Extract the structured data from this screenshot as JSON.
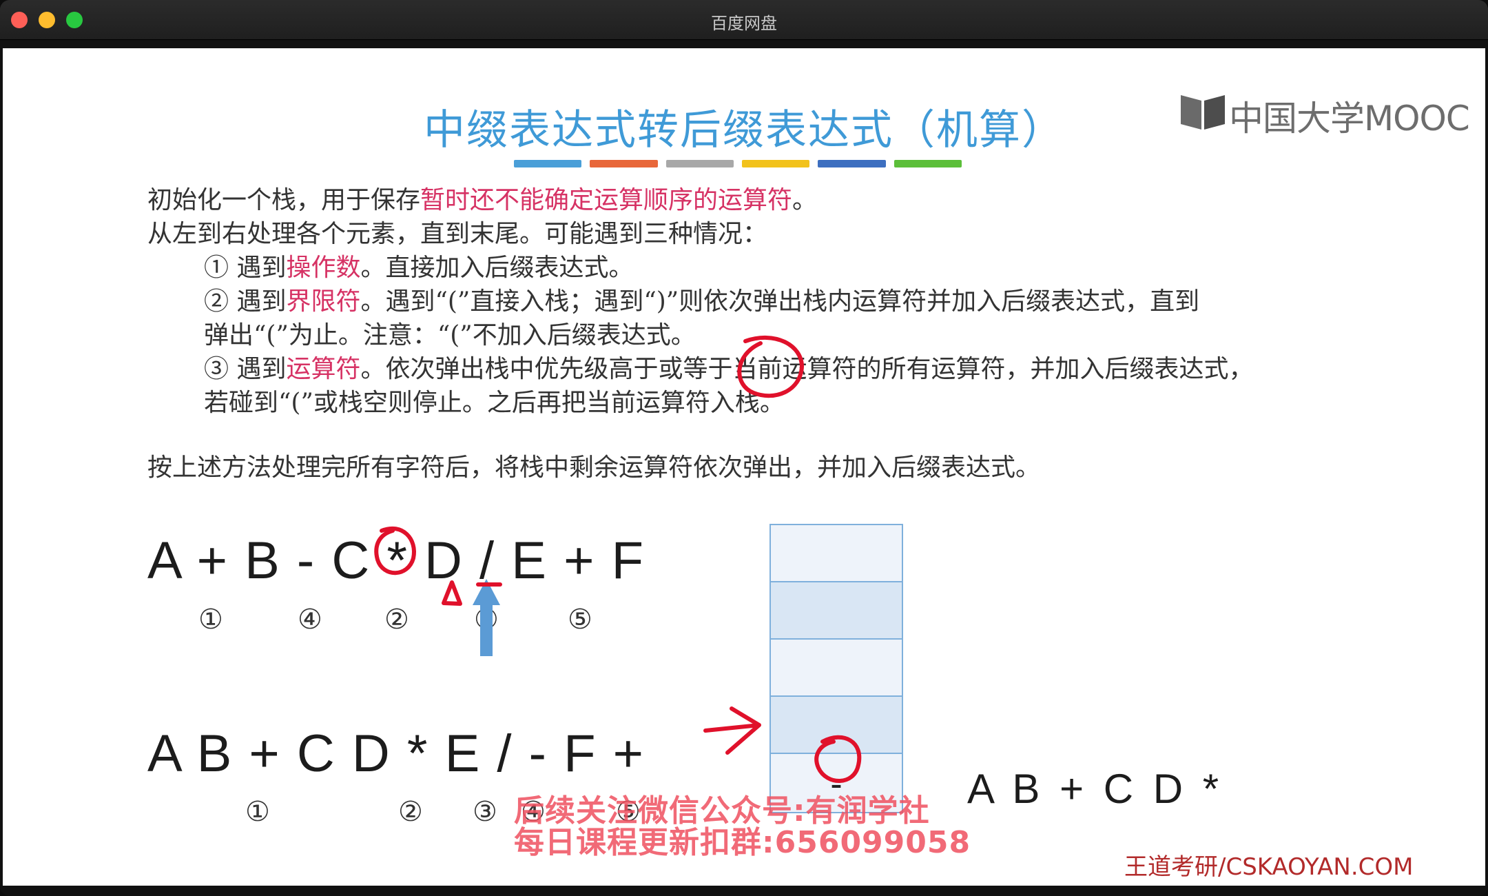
{
  "window": {
    "title": "百度网盘"
  },
  "slide": {
    "logo_text": "中国大学MOOC",
    "title": "中缀表达式转后缀表达式（机算）",
    "accent_bars": [
      "#4a9fd8",
      "#e8673a",
      "#a8a8a8",
      "#f2c21b",
      "#3d6fc0",
      "#5cbf3a"
    ],
    "lines": {
      "l1_pre": "初始化一个栈，用于保存",
      "l1_hl": "暂时还不能确定运算顺序的运算符",
      "l1_post": "。",
      "l2": "从左到右处理各个元素，直到末尾。可能遇到三种情况：",
      "c1_pre": "① 遇到",
      "c1_hl": "操作数",
      "c1_post": "。直接加入后缀表达式。",
      "c2_pre": "② 遇到",
      "c2_hl": "界限符",
      "c2_post": "。遇到“(”直接入栈；遇到“)”则依次弹出栈内运算符并加入后缀表达式，直到",
      "c2_cont": "弹出“(”为止。注意：“(”不加入后缀表达式。",
      "c3_pre": "③ 遇到",
      "c3_hl": "运算符",
      "c3_post": "。依次弹出栈中优先级高于或等于当前运算符的所有运算符，并加入后缀表达式，",
      "c3_cont": "若碰到“(”或栈空则停止。之后再把当前运算符入栈。",
      "final": "按上述方法处理完所有字符后，将栈中剩余运算符依次弹出，并加入后缀表达式。"
    },
    "infix": "A + B - C * D / E + F",
    "infix_order": [
      "①",
      "④",
      "②",
      "③",
      "⑤"
    ],
    "postfix": "A B + C D * E / - F +",
    "postfix_order": [
      "①",
      "②",
      "③",
      "④",
      "⑤"
    ],
    "stack_bottom_value": "-",
    "result": "A B + C D *",
    "watermark_line1": "后续关注微信公众号:有润学社",
    "watermark_line2": "每日课程更新扣群:656099058",
    "footer": "王道考研/CSKAOYAN.COM"
  }
}
